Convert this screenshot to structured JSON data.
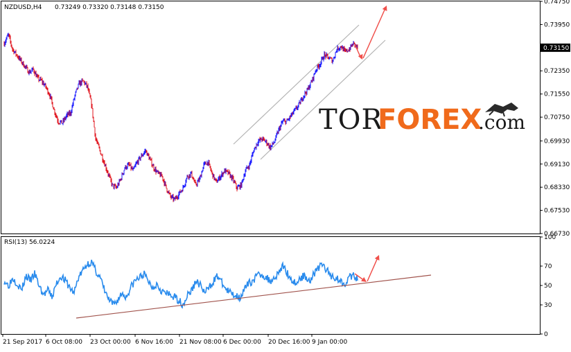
{
  "header": {
    "symbol": "NZDUSD,H4",
    "ohlc": "0.73249 0.73320 0.73148 0.73150"
  },
  "rsi_header": "RSI(13) 56.0224",
  "watermark": {
    "part1": "TOR",
    "part2": "FOREX",
    "part3": ".com"
  },
  "price_axis_labels": [
    "0.74750",
    "0.73950",
    "0.73150",
    "0.72350",
    "0.71550",
    "0.70750",
    "0.69930",
    "0.69130",
    "0.68330",
    "0.67530",
    "0.66730"
  ],
  "current_price_label": "0.73150",
  "rsi_axis_labels": [
    "100",
    "70",
    "50",
    "30",
    "0"
  ],
  "time_labels": [
    "21 Sep 2017",
    "6 Oct 08:00",
    "23 Oct 00:00",
    "6 Nov 16:00",
    "21 Nov 08:00",
    "6 Dec 00:00",
    "20 Dec 16:00",
    "9 Jan 00:00"
  ],
  "colors": {
    "up": "#1a1aff",
    "down": "#e0141e",
    "rsi": "#2b8ced",
    "trend_channel": "#b4b4b4",
    "rsi_trendline": "#a0524b",
    "arrow": "#f0504b",
    "grid_border": "#000000"
  },
  "chart_data": [
    {
      "type": "line",
      "name_hint": "price",
      "yscale": "linear",
      "ylim": [
        0.6673,
        0.7475
      ],
      "x": [
        "21 Sep 2017",
        "6 Oct 08:00",
        "23 Oct 00:00",
        "6 Nov 16:00",
        "21 Nov 08:00",
        "6 Dec 00:00",
        "20 Dec 16:00",
        "9 Jan 00:00"
      ],
      "path_points": [
        [
          0.0,
          0.733
        ],
        [
          1.2,
          0.736
        ],
        [
          2.0,
          0.731
        ],
        [
          3.0,
          0.729
        ],
        [
          4.0,
          0.727
        ],
        [
          5.0,
          0.725
        ],
        [
          6.0,
          0.723
        ],
        [
          7.0,
          0.724
        ],
        [
          8.0,
          0.721
        ],
        [
          9.0,
          0.72
        ],
        [
          10.0,
          0.718
        ],
        [
          11.0,
          0.715
        ],
        [
          12.0,
          0.71
        ],
        [
          13.0,
          0.706
        ],
        [
          14.0,
          0.7055
        ],
        [
          15.0,
          0.708
        ],
        [
          16.0,
          0.709
        ],
        [
          17.0,
          0.715
        ],
        [
          18.0,
          0.719
        ],
        [
          19.0,
          0.72
        ],
        [
          20.0,
          0.718
        ],
        [
          21.0,
          0.712
        ],
        [
          22.0,
          0.7
        ],
        [
          23.0,
          0.696
        ],
        [
          24.0,
          0.692
        ],
        [
          25.0,
          0.688
        ],
        [
          26.0,
          0.684
        ],
        [
          27.0,
          0.683
        ],
        [
          28.0,
          0.686
        ],
        [
          29.0,
          0.69
        ],
        [
          30.0,
          0.691
        ],
        [
          31.0,
          0.689
        ],
        [
          32.0,
          0.692
        ],
        [
          33.0,
          0.694
        ],
        [
          34.0,
          0.696
        ],
        [
          35.0,
          0.693
        ],
        [
          36.0,
          0.69
        ],
        [
          37.0,
          0.688
        ],
        [
          38.0,
          0.687
        ],
        [
          39.0,
          0.683
        ],
        [
          40.0,
          0.68
        ],
        [
          41.0,
          0.679
        ],
        [
          42.0,
          0.681
        ],
        [
          43.0,
          0.683
        ],
        [
          44.0,
          0.687
        ],
        [
          45.0,
          0.688
        ],
        [
          46.0,
          0.684
        ],
        [
          47.0,
          0.686
        ],
        [
          48.0,
          0.691
        ],
        [
          49.0,
          0.692
        ],
        [
          50.0,
          0.688
        ],
        [
          51.0,
          0.685
        ],
        [
          52.0,
          0.687
        ],
        [
          53.0,
          0.689
        ],
        [
          54.0,
          0.688
        ],
        [
          55.0,
          0.686
        ],
        [
          56.0,
          0.683
        ],
        [
          57.0,
          0.684
        ],
        [
          58.0,
          0.689
        ],
        [
          59.0,
          0.691
        ],
        [
          60.0,
          0.696
        ],
        [
          61.0,
          0.699
        ],
        [
          62.0,
          0.7
        ],
        [
          63.0,
          0.699
        ],
        [
          64.0,
          0.697
        ],
        [
          65.0,
          0.699
        ],
        [
          66.0,
          0.703
        ],
        [
          67.0,
          0.706
        ],
        [
          68.0,
          0.706
        ],
        [
          69.0,
          0.708
        ],
        [
          70.0,
          0.71
        ],
        [
          71.0,
          0.712
        ],
        [
          72.0,
          0.715
        ],
        [
          73.0,
          0.717
        ],
        [
          74.0,
          0.72
        ],
        [
          75.0,
          0.724
        ],
        [
          76.0,
          0.726
        ],
        [
          77.0,
          0.729
        ],
        [
          78.0,
          0.728
        ],
        [
          79.0,
          0.727
        ],
        [
          80.0,
          0.731
        ],
        [
          81.0,
          0.732
        ],
        [
          82.0,
          0.73
        ],
        [
          83.0,
          0.731
        ],
        [
          84.0,
          0.733
        ],
        [
          85.0,
          0.7315
        ]
      ]
    },
    {
      "type": "line",
      "name_hint": "RSI(13)",
      "ylim": [
        0,
        100
      ],
      "yticks": [
        0,
        30,
        50,
        70,
        100
      ],
      "last_value": 56.0224,
      "values": [
        55,
        50,
        58,
        52,
        45,
        60,
        55,
        62,
        50,
        40,
        45,
        38,
        52,
        60,
        55,
        48,
        42,
        58,
        65,
        72,
        74,
        65,
        58,
        45,
        35,
        30,
        35,
        42,
        38,
        48,
        55,
        58,
        62,
        55,
        48,
        52,
        45,
        42,
        40,
        38,
        35,
        30,
        40,
        45,
        55,
        50,
        42,
        48,
        55,
        60,
        52,
        45,
        42,
        40,
        38,
        45,
        52,
        55,
        60,
        62,
        58,
        55,
        58,
        65,
        70,
        62,
        55,
        52,
        58,
        60,
        55,
        62,
        68,
        72,
        65,
        60,
        58,
        55,
        52,
        58,
        60,
        56
      ]
    }
  ]
}
